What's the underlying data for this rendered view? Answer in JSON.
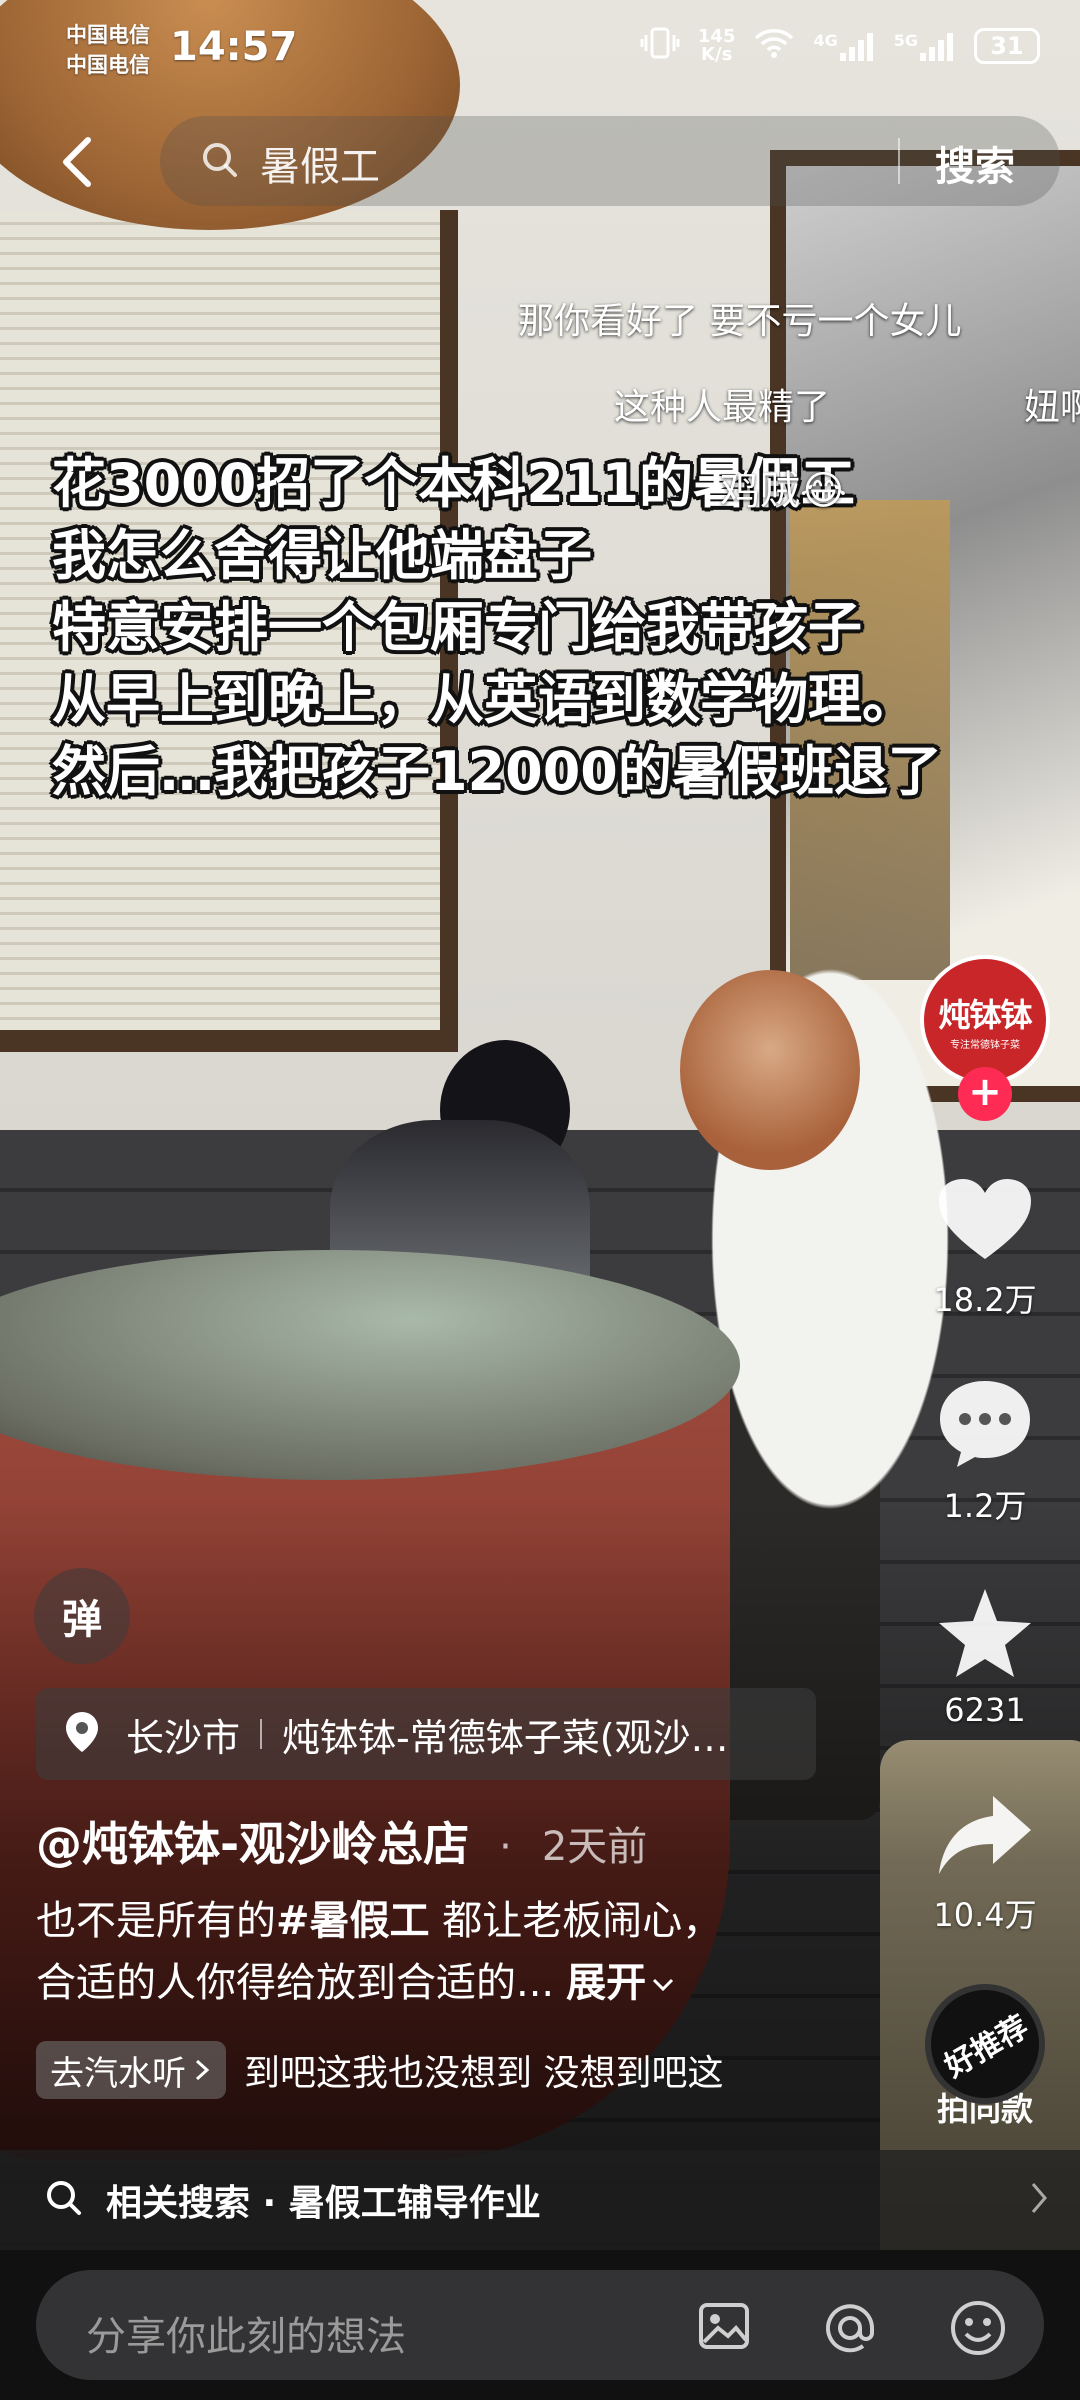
{
  "status_bar": {
    "carrier1": "中国电信",
    "carrier2": "中国电信",
    "time": "14:57",
    "net_speed_value": "145",
    "net_speed_unit": "K/s",
    "signal1": "4G",
    "signal2": "5G",
    "battery": "31"
  },
  "search": {
    "query": "暑假工",
    "button_label": "搜索"
  },
  "danmaku": [
    "那你看好了  要不亏一个女儿",
    "这种人最精了",
    "妞啊"
  ],
  "caption_lines": [
    "花3000招了个本科211的暑假工",
    "我怎么舍得让他端盘子",
    "特意安排一个包厢专门给我带孩子",
    "从早上到晚上，从英语到数学物理。",
    "然后…我把孩子12000的暑假班退了"
  ],
  "caption_danmaku": "鸡贼😂",
  "creator_avatar": {
    "brand": "炖钵钵",
    "slogan": "专注常德钵子菜"
  },
  "actions": {
    "likes": "18.2万",
    "comments": "1.2万",
    "favorites": "6231",
    "shares": "10.4万"
  },
  "danmaku_toggle": "弹",
  "location": {
    "city": "长沙市",
    "poi": "炖钵钵-常德钵子菜(观沙…"
  },
  "author": {
    "name": "@炖钵钵-观沙岭总店",
    "separator": "·",
    "time": "2天前"
  },
  "description": {
    "line1_prefix": "也不是所有的",
    "hashtag": "#暑假工",
    "line1_suffix": " 都让老板闹心，",
    "line2": "合适的人你得给放到合适的...",
    "more": "展开"
  },
  "music": {
    "chip": "去汽水听",
    "title": "到吧这我也没想到    没想到吧这"
  },
  "same_style": {
    "disc": "好推荐",
    "label": "拍同款"
  },
  "related_search": {
    "label": "相关搜索 · 暑假工辅导作业"
  },
  "comment": {
    "placeholder": "分享你此刻的想法"
  },
  "colors": {
    "follow": "#fe2c55",
    "avatar": "#c9262a"
  }
}
